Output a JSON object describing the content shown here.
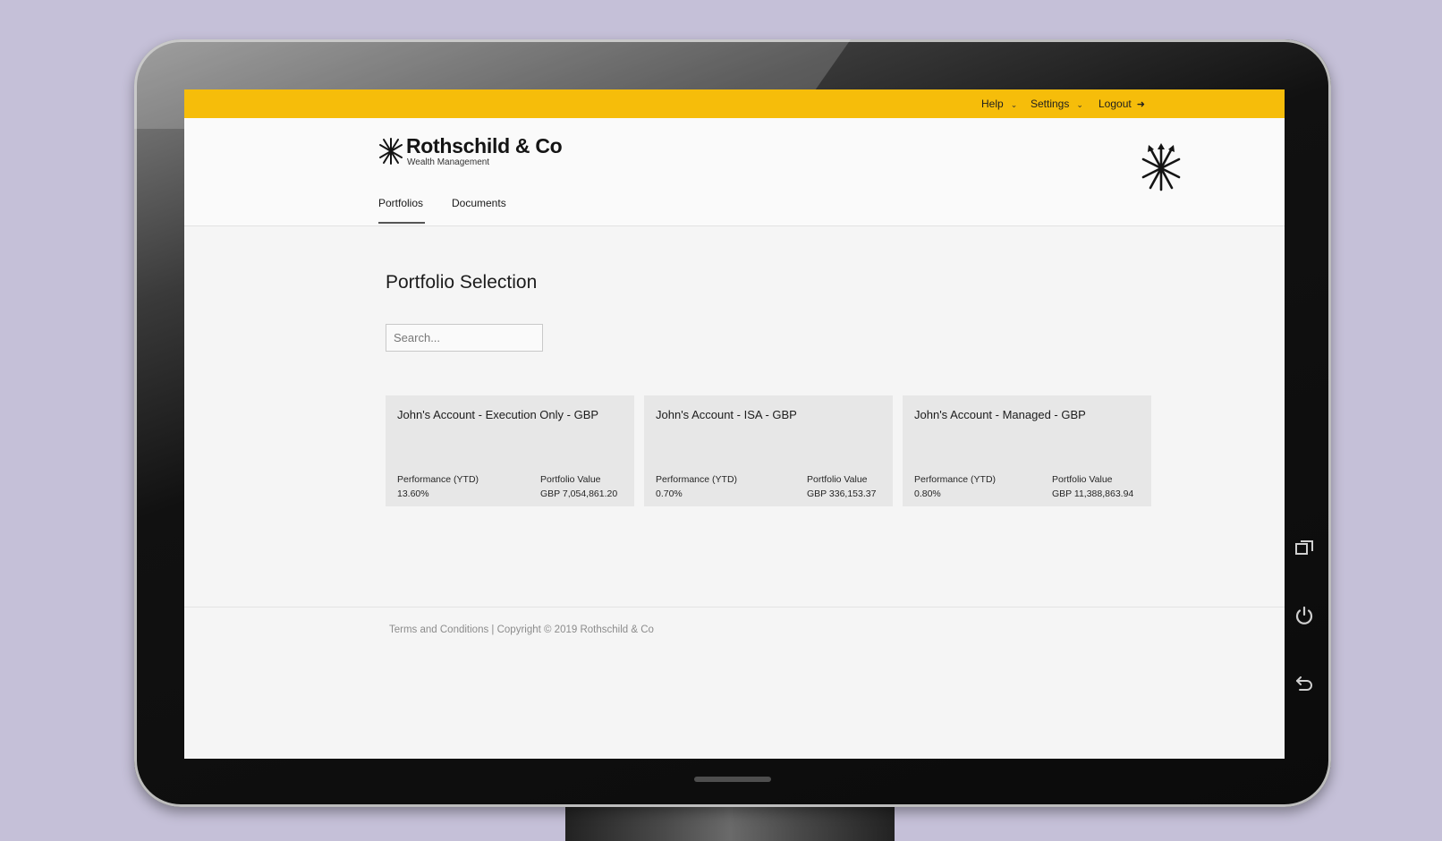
{
  "topbar": {
    "help": "Help",
    "settings": "Settings",
    "logout": "Logout"
  },
  "brand": {
    "name": "Rothschild & Co",
    "subtitle": "Wealth Management"
  },
  "nav": {
    "tabs": [
      {
        "label": "Portfolios",
        "active": true
      },
      {
        "label": "Documents",
        "active": false
      }
    ]
  },
  "main": {
    "title": "Portfolio Selection",
    "search_placeholder": "Search..."
  },
  "portfolios": [
    {
      "name": "John's Account - Execution Only - GBP",
      "performance_label": "Performance (YTD)",
      "performance": "13.60%",
      "value_label": "Portfolio Value",
      "value": "GBP 7,054,861.20"
    },
    {
      "name": "John's Account - ISA - GBP",
      "performance_label": "Performance (YTD)",
      "performance": "0.70%",
      "value_label": "Portfolio Value",
      "value": "GBP 336,153.37"
    },
    {
      "name": "John's Account - Managed - GBP",
      "performance_label": "Performance (YTD)",
      "performance": "0.80%",
      "value_label": "Portfolio Value",
      "value": "GBP 11,388,863.94"
    }
  ],
  "footer": {
    "text": "Terms and Conditions | Copyright © 2019 Rothschild & Co"
  },
  "colors": {
    "accent": "#f6bd0a",
    "background": "#c5c0d8",
    "card": "#e7e7e7"
  },
  "icons": {
    "logo": "arrows-bundle-icon",
    "logout": "logout-icon",
    "device_buttons": [
      "windows-icon",
      "power-icon",
      "back-icon"
    ]
  }
}
